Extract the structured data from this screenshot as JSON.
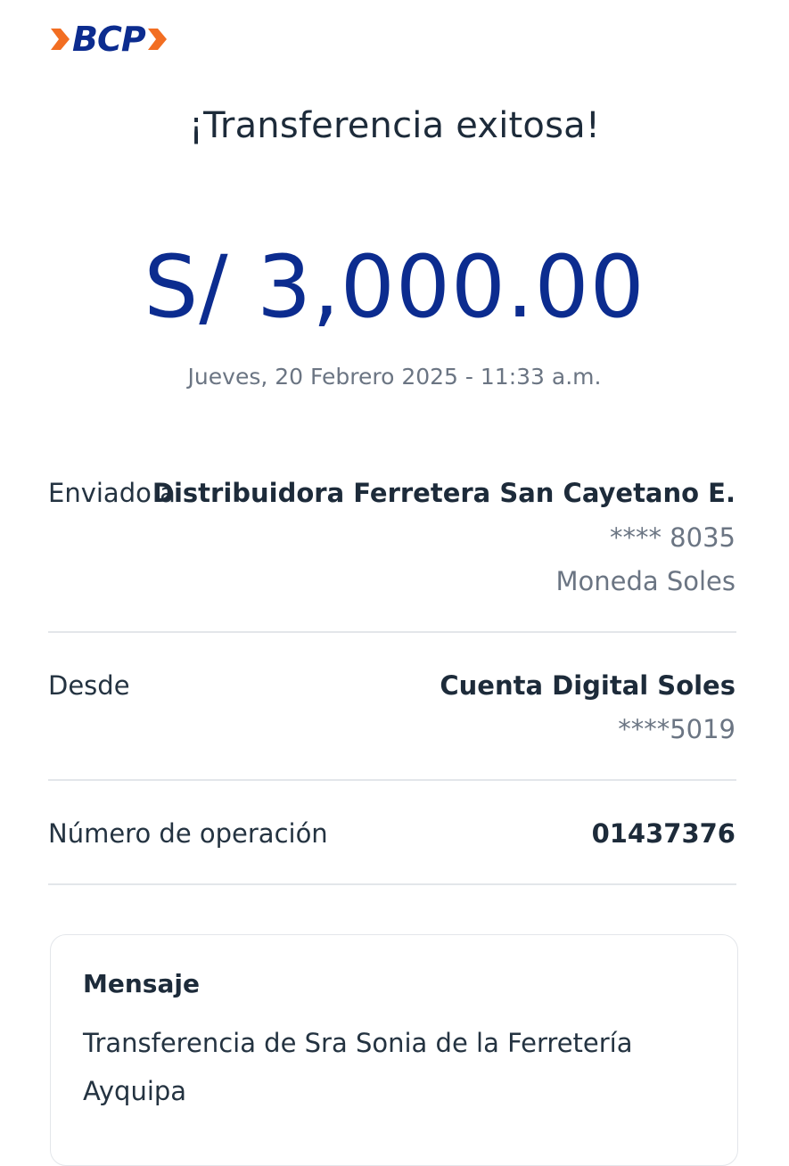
{
  "brand": {
    "logo_text": "BCP",
    "accent_color": "#f26e22",
    "brand_color": "#0c2c8f"
  },
  "header": {
    "title": "¡Transferencia exitosa!"
  },
  "transfer": {
    "amount": "S/ 3,000.00",
    "datetime": "Jueves, 20 Febrero 2025 - 11:33 a.m."
  },
  "details": {
    "recipient": {
      "label": "Enviado a",
      "name": "Distribuidora Ferretera San Cayetano E.",
      "account": "**** 8035",
      "currency": "Moneda Soles"
    },
    "source": {
      "label": "Desde",
      "account_name": "Cuenta Digital Soles",
      "account": "****5019"
    },
    "operation": {
      "label": "Número de operación",
      "number": "01437376"
    }
  },
  "message": {
    "title": "Mensaje",
    "body": "Transferencia de Sra Sonia de la Ferretería Ayquipa"
  }
}
